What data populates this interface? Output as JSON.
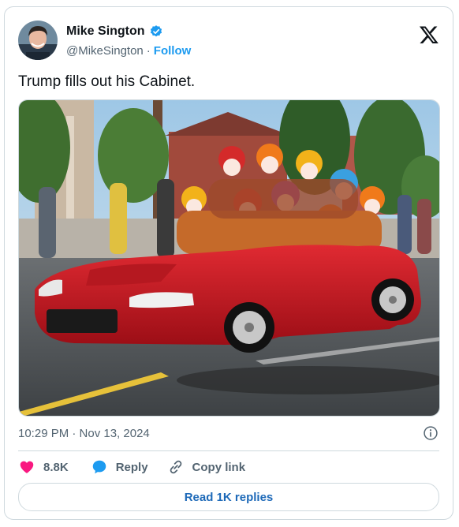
{
  "author": {
    "name": "Mike Sington",
    "handle": "@MikeSington",
    "separator": "·",
    "follow_label": "Follow",
    "verified_color": "#1d9bf0"
  },
  "tweet": {
    "text": "Trump fills out his Cabinet.",
    "timestamp": "10:29 PM · Nov 13, 2024",
    "media_description_icon": "photo"
  },
  "actions": {
    "like_count": "8.8K",
    "reply_label": "Reply",
    "copy_link_label": "Copy link",
    "like_color": "#f91880",
    "reply_color": "#1d9bf0"
  },
  "footer": {
    "read_replies_label": "Read 1K replies"
  }
}
